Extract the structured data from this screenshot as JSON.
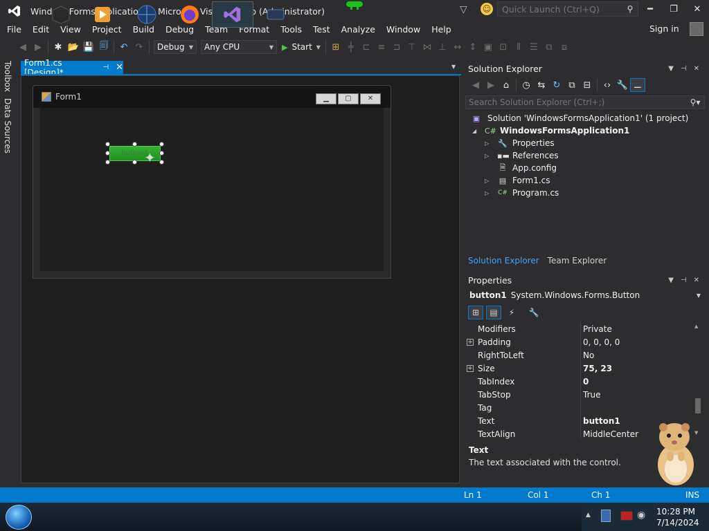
{
  "window": {
    "title": "WindowsFormsApplication1 - Microsoft Visual Studio (Administrator)",
    "quick_launch_placeholder": "Quick Launch (Ctrl+Q)",
    "controls": [
      "minimize",
      "restore",
      "close"
    ]
  },
  "menu": {
    "items": [
      "File",
      "Edit",
      "View",
      "Project",
      "Build",
      "Debug",
      "Team",
      "Format",
      "Tools",
      "Test",
      "Analyze",
      "Window",
      "Help"
    ],
    "signin": "Sign in"
  },
  "toolbar": {
    "config": "Debug",
    "platform": "Any CPU",
    "start": "Start"
  },
  "side_tabs": [
    "Toolbox",
    "Data Sources"
  ],
  "document": {
    "tab_label": "Form1.cs [Design]*",
    "form_title": "Form1",
    "button_text": "button1"
  },
  "solution_explorer": {
    "title": "Solution Explorer",
    "search_placeholder": "Search Solution Explorer (Ctrl+;)",
    "tree": [
      {
        "label": "Solution 'WindowsFormsApplication1' (1 project)",
        "icon": "solution-icon"
      },
      {
        "label": "WindowsFormsApplication1",
        "icon": "csharp-project-icon"
      },
      {
        "label": "Properties",
        "icon": "wrench-icon"
      },
      {
        "label": "References",
        "icon": "references-icon"
      },
      {
        "label": "App.config",
        "icon": "config-file-icon"
      },
      {
        "label": "Form1.cs",
        "icon": "form-icon"
      },
      {
        "label": "Program.cs",
        "icon": "csharp-file-icon"
      }
    ],
    "tabs": [
      "Solution Explorer",
      "Team Explorer"
    ]
  },
  "properties": {
    "title": "Properties",
    "target_name": "button1",
    "target_type": "System.Windows.Forms.Button",
    "rows": [
      {
        "name": "Modifiers",
        "value": "Private",
        "bold": false,
        "expandable": false
      },
      {
        "name": "Padding",
        "value": "0, 0, 0, 0",
        "bold": false,
        "expandable": true
      },
      {
        "name": "RightToLeft",
        "value": "No",
        "bold": false,
        "expandable": false
      },
      {
        "name": "Size",
        "value": "75, 23",
        "bold": true,
        "expandable": true
      },
      {
        "name": "TabIndex",
        "value": "0",
        "bold": true,
        "expandable": false
      },
      {
        "name": "TabStop",
        "value": "True",
        "bold": false,
        "expandable": false
      },
      {
        "name": "Tag",
        "value": "",
        "bold": false,
        "expandable": false
      },
      {
        "name": "Text",
        "value": "button1",
        "bold": true,
        "expandable": false
      },
      {
        "name": "TextAlign",
        "value": "MiddleCenter",
        "bold": false,
        "expandable": false
      }
    ],
    "desc_title": "Text",
    "desc_text": "The text associated with the control."
  },
  "status": {
    "ln": "Ln 1",
    "col": "Col 1",
    "ch": "Ch 1",
    "mode": "INS"
  },
  "taskbar": {
    "time": "10:28 PM",
    "date": "7/14/2024"
  },
  "colors": {
    "accent": "#007acc",
    "background": "#2d2d30",
    "editor": "#1e1e1e"
  }
}
